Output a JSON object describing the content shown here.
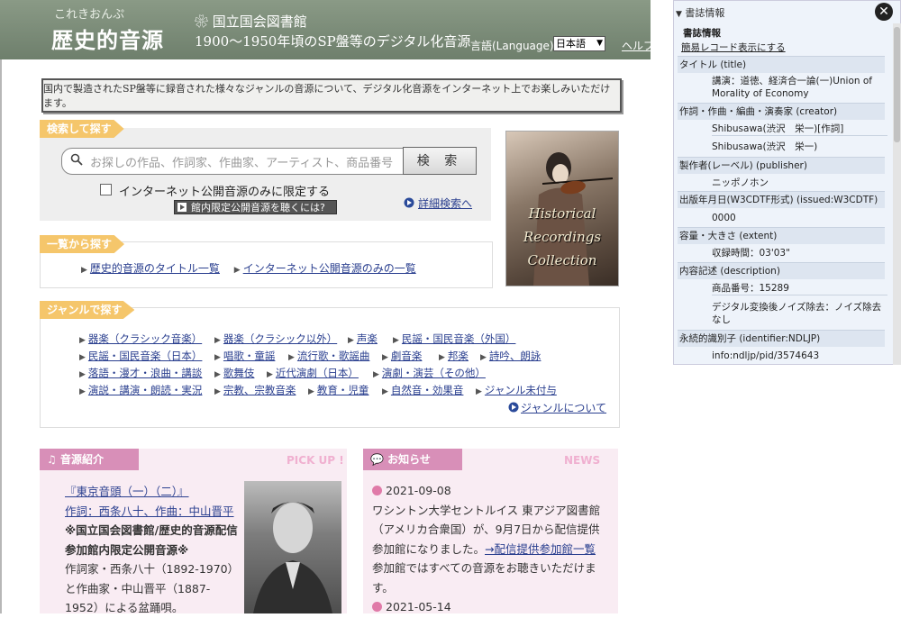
{
  "header": {
    "logo_top": "これきおんぷ",
    "logo_main": "歴史的音源",
    "ndl_name": "国立国会図書館",
    "subtitle": "1900～1950年頃のSP盤等のデジタル化音源",
    "lang_label": "言語(Language):",
    "lang_selected": "日本語",
    "help": "ヘルプ"
  },
  "intro": "国内で製造されたSP盤等に録音された様々なジャンルの音源について、デジタル化音源をインターネット上でお楽しみいただけます。",
  "search": {
    "tag": "検索して探す",
    "placeholder": "お探しの作品、作詞家、作曲家、アーティスト、商品番号",
    "button": "検 索",
    "checkbox_label": "インターネット公開音源のみに限定する",
    "onsite_button": "館内限定公開音源を聴くには?",
    "advanced": "詳細検索へ"
  },
  "photo_alt": "Historical Recordings Collection",
  "list": {
    "tag": "一覧から探す",
    "items": [
      "歴史的音源のタイトル一覧",
      "インターネット公開音源のみの一覧"
    ]
  },
  "genre": {
    "tag": "ジャンルで探す",
    "rows": [
      [
        "器楽（クラシック音楽）",
        "器楽（クラシック以外）",
        "声楽",
        "民謡・国民音楽（外国）"
      ],
      [
        "民謡・国民音楽（日本）",
        "唱歌・童謡",
        "流行歌・歌謡曲",
        "劇音楽",
        "邦楽",
        "詩吟、朗詠"
      ],
      [
        "落語・漫才・浪曲・講談",
        "歌舞伎",
        "近代演劇（日本）",
        "演劇・演芸（その他）"
      ],
      [
        "演説・講演・朗読・実況",
        "宗教、宗教音楽",
        "教育・児童",
        "自然音・効果音",
        "ジャンル未付与"
      ]
    ],
    "about": "ジャンルについて"
  },
  "pickup": {
    "tag": "音源紹介",
    "en": "PICK UP !",
    "title": "『東京音頭（一）（二）』",
    "credit": "作詞：西条八十、作曲：中山晋平",
    "note": "※国立国会図書館/歴史的音源配信参加館内限定公開音源※",
    "body": "作詞家・西条八十（1892-1970）と作曲家・中山晋平（1887-1952）による盆踊唄。"
  },
  "news": {
    "tag": "お知らせ",
    "en": "NEWS",
    "date1": "2021-09-08",
    "text1a": "ワシントン大学セントルイス 東アジア図書館（アメリカ合衆国）が、9月7日から配信提供参加館になりました。",
    "link1": "→配信提供参加館一覧",
    "text1b": "参加館ではすべての音源をお聴きいただけます。",
    "date2": "2021-05-14"
  },
  "panel": {
    "head": "書誌情報",
    "section": "書誌情報",
    "simple_link": "簡易レコード表示にする",
    "fields": [
      {
        "label": "タイトル (title)",
        "values": [
          "講演：道徳、経済合一論(一)Union of Morality of Economy"
        ]
      },
      {
        "label": "作詞・作曲・編曲・演奏家 (creator)",
        "values": [
          "Shibusawa(渋沢　栄一)[作詞]",
          "Shibusawa(渋沢　栄一)"
        ]
      },
      {
        "label": "製作者(レーベル) (publisher)",
        "values": [
          "ニッポノホン"
        ]
      },
      {
        "label": "出版年月日(W3CDTF形式) (issued:W3CDTF)",
        "values": [
          "0000"
        ]
      },
      {
        "label": "容量・大きさ (extent)",
        "values": [
          "収録時間：03'03\""
        ]
      },
      {
        "label": "内容記述 (description)",
        "values": [
          "商品番号：15289",
          "デジタル変換後ノイズ除去：ノイズ除去なし"
        ]
      },
      {
        "label": "永続的識別子 (identifier:NDLJP)",
        "values": [
          "info:ndljp/pid/3574643"
        ]
      }
    ]
  }
}
